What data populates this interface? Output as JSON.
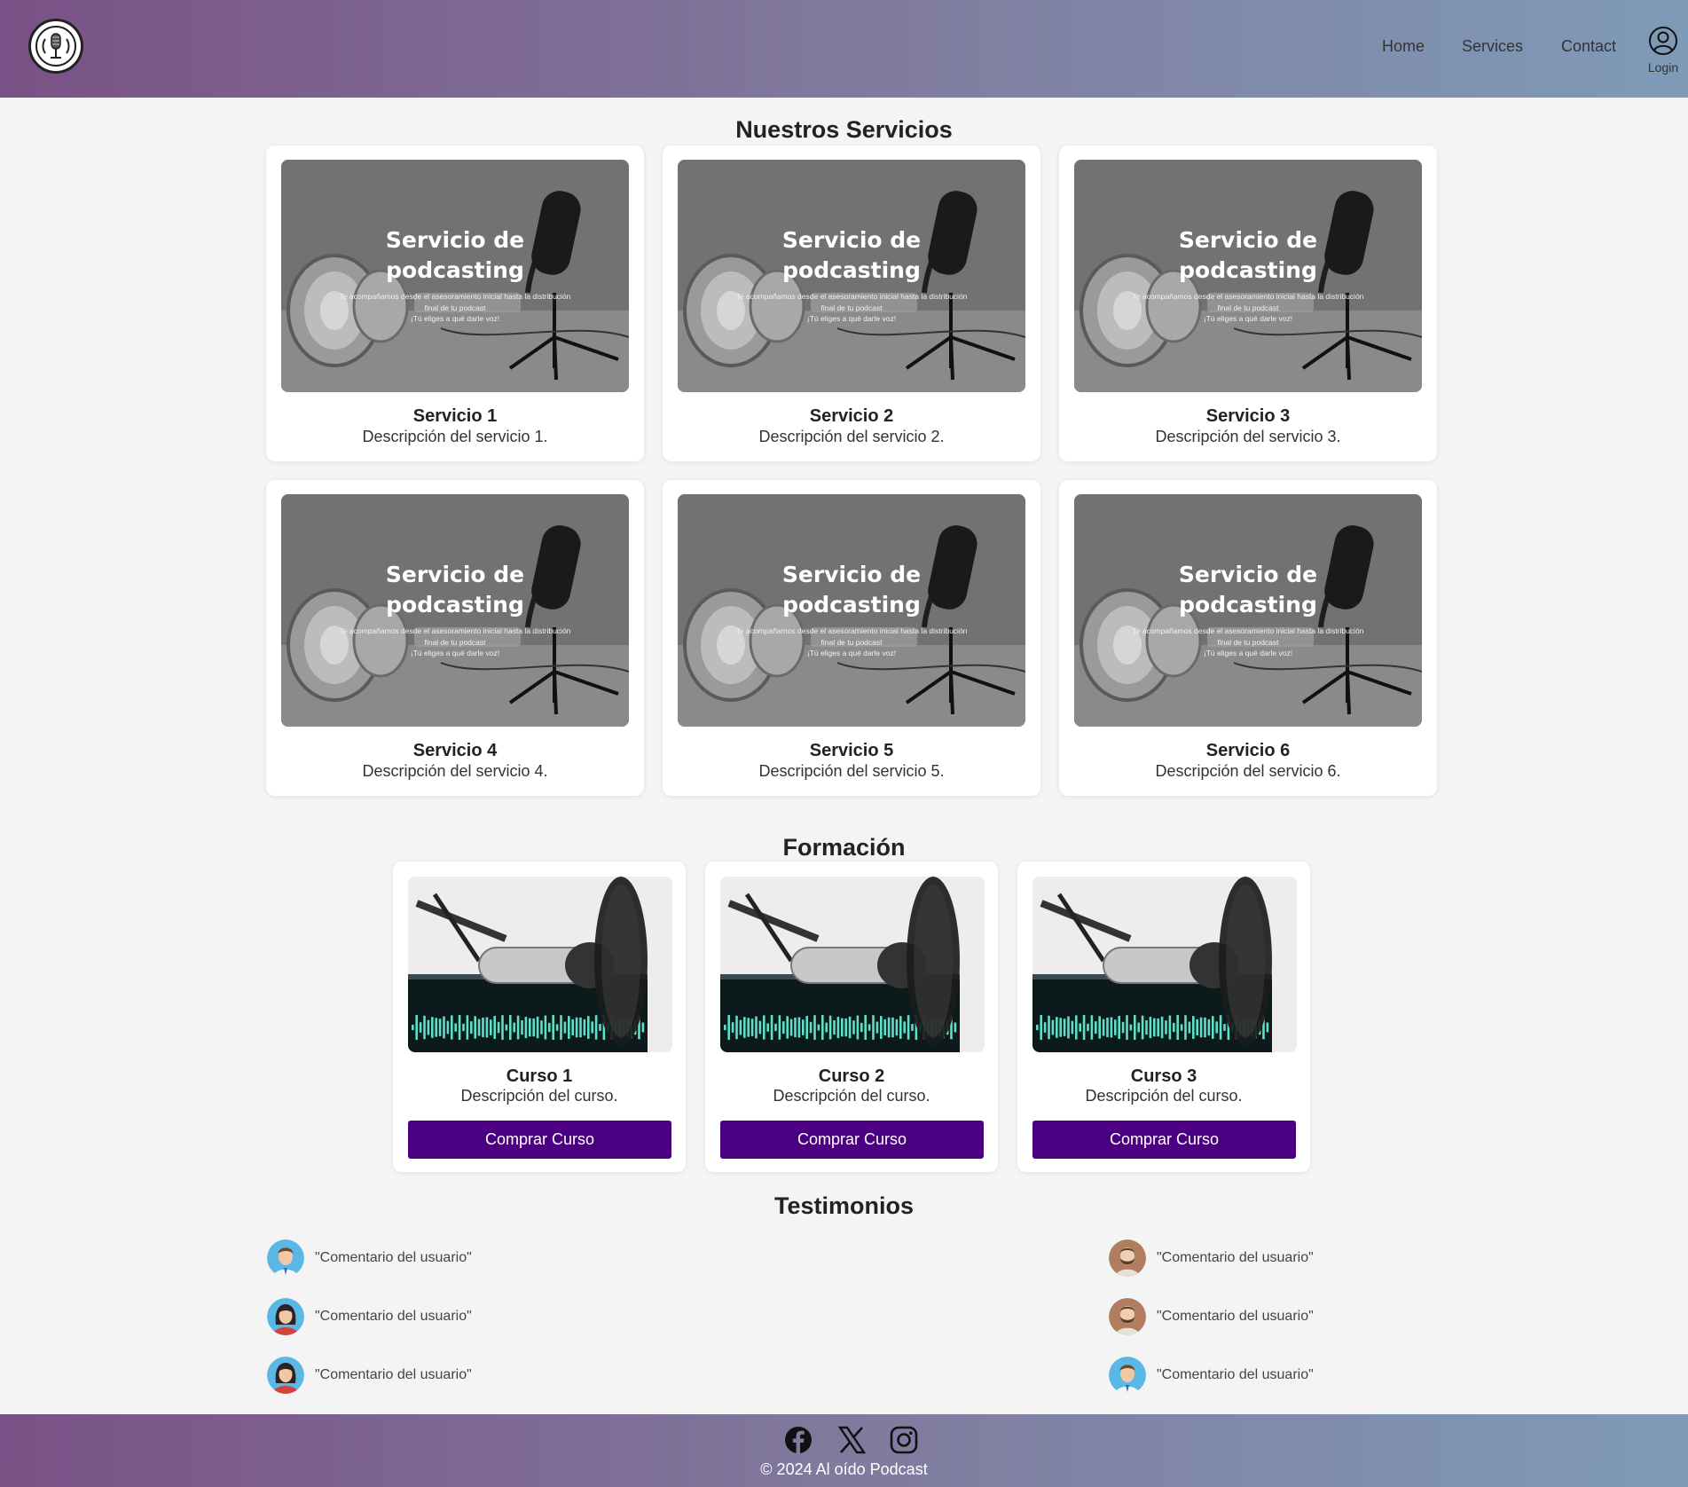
{
  "header": {
    "nav": [
      "Home",
      "Services",
      "Contact"
    ],
    "login_label": "Login"
  },
  "services": {
    "title": "Nuestros Servicios",
    "image_headline_line1": "Servicio de",
    "image_headline_line2": "podcasting",
    "image_sub_line1": "Te acompañamos desde el asesoramiento inicial hasta la distribución",
    "image_sub_line2": "final de tu podcast",
    "image_sub_line3": "¡Tú eliges a qué darle voz!",
    "items": [
      {
        "title": "Servicio 1",
        "desc": "Descripción del servicio 1."
      },
      {
        "title": "Servicio 2",
        "desc": "Descripción del servicio 2."
      },
      {
        "title": "Servicio 3",
        "desc": "Descripción del servicio 3."
      },
      {
        "title": "Servicio 4",
        "desc": "Descripción del servicio 4."
      },
      {
        "title": "Servicio 5",
        "desc": "Descripción del servicio 5."
      },
      {
        "title": "Servicio 6",
        "desc": "Descripción del servicio 6."
      }
    ]
  },
  "training": {
    "title": "Formación",
    "courses": [
      {
        "title": "Curso 1",
        "desc": "Descripción del curso.",
        "button": "Comprar Curso"
      },
      {
        "title": "Curso 2",
        "desc": "Descripción del curso.",
        "button": "Comprar Curso"
      },
      {
        "title": "Curso 3",
        "desc": "Descripción del curso.",
        "button": "Comprar Curso"
      }
    ]
  },
  "testimonials": {
    "title": "Testimonios",
    "left": [
      {
        "avatar": "man-avatar-icon",
        "text": "\"Comentario del usuario\""
      },
      {
        "avatar": "woman-avatar-icon",
        "text": "\"Comentario del usuario\""
      },
      {
        "avatar": "woman-avatar-icon",
        "text": "\"Comentario del usuario\""
      }
    ],
    "right": [
      {
        "avatar": "bearded-man-avatar-icon",
        "text": "\"Comentario del usuario\""
      },
      {
        "avatar": "bearded-man-avatar-icon",
        "text": "\"Comentario del usuario\""
      },
      {
        "avatar": "man-avatar-icon",
        "text": "\"Comentario del usuario\""
      }
    ]
  },
  "footer": {
    "social": [
      "facebook-icon",
      "x-icon",
      "instagram-icon"
    ],
    "copyright": "© 2024 Al oído Podcast"
  },
  "colors": {
    "header_start": "#7a5186",
    "header_end": "#7f9bb8",
    "button": "#4b0082",
    "background": "#f4f4f4"
  }
}
